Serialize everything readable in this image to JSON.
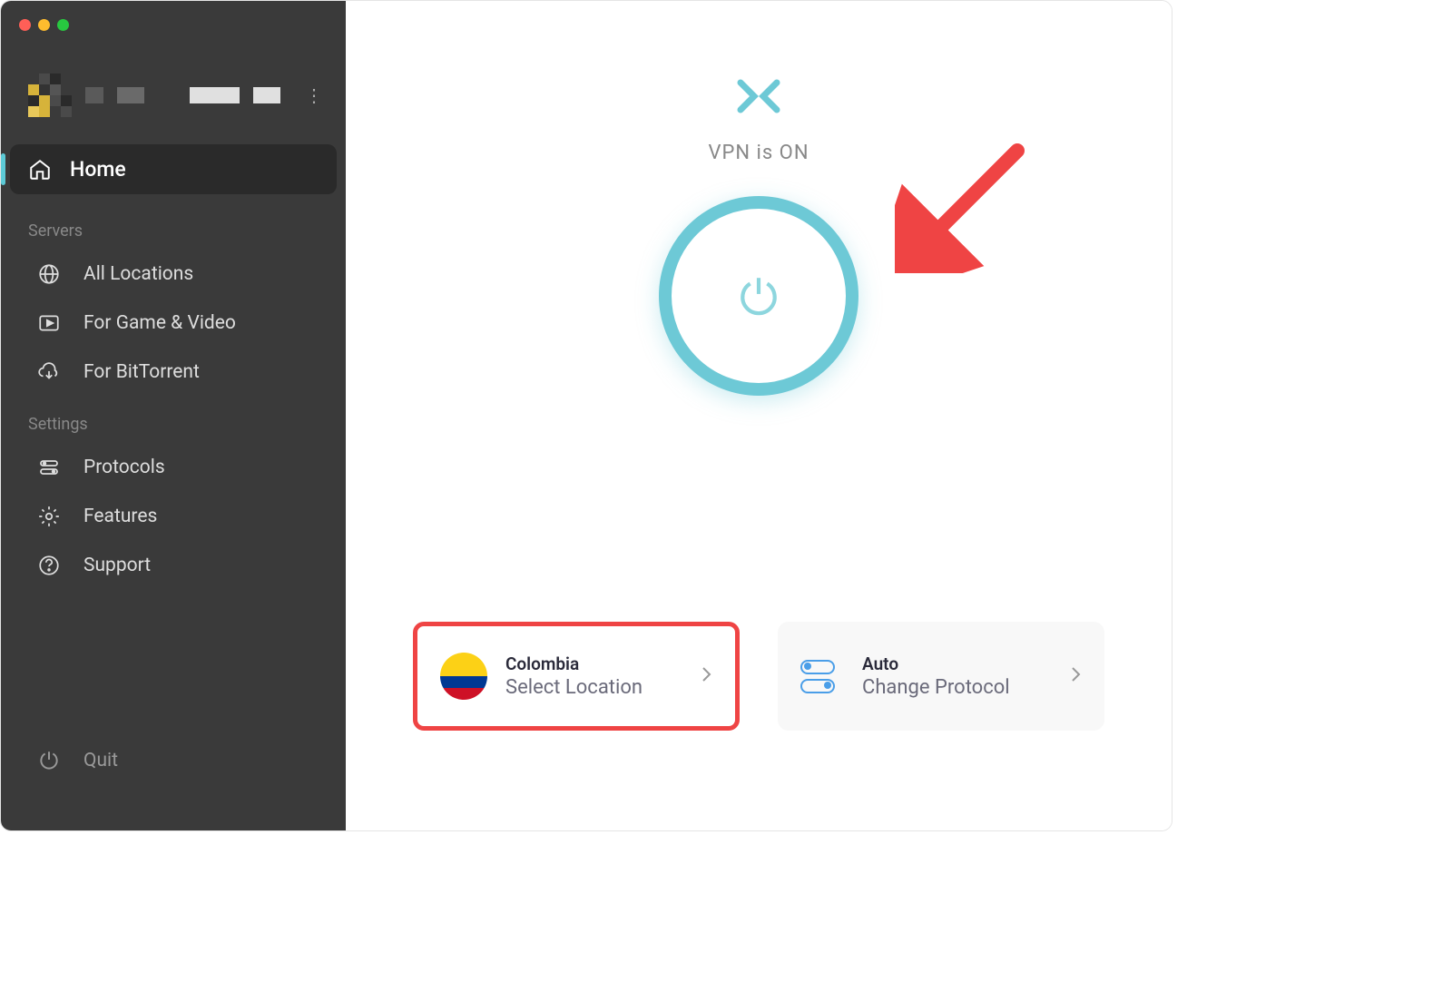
{
  "sidebar": {
    "home": "Home",
    "section_servers": "Servers",
    "section_settings": "Settings",
    "items": {
      "all_locations": "All Locations",
      "game_video": "For Game & Video",
      "bittorrent": "For BitTorrent",
      "protocols": "Protocols",
      "features": "Features",
      "support": "Support",
      "quit": "Quit"
    }
  },
  "main": {
    "status": "VPN is ON",
    "location_card": {
      "title": "Colombia",
      "subtitle": "Select Location"
    },
    "protocol_card": {
      "title": "Auto",
      "subtitle": "Change Protocol"
    }
  },
  "colors": {
    "accent": "#6dc9d6",
    "highlight": "#ef4444"
  }
}
